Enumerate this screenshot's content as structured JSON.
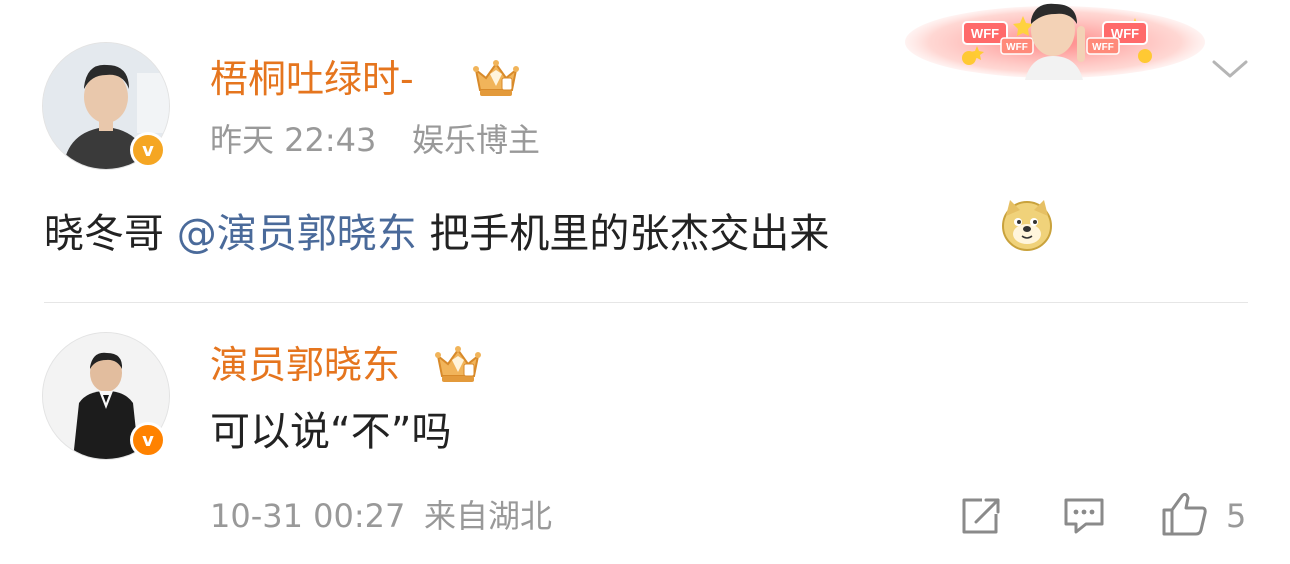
{
  "post": {
    "username": "梧桐吐绿时-",
    "time": "昨天 22:43",
    "role": "娱乐博主",
    "text_before": "晓冬哥 ",
    "mention": "@演员郭晓东",
    "text_after": " 把手机里的张杰交出来",
    "emoji": "doge-icon",
    "more": "chevron-down-icon"
  },
  "banner": {
    "badge_left": "WFF",
    "badge_left_small": "WFF",
    "badge_right": "WFF",
    "badge_right_small": "WFF"
  },
  "reply": {
    "username": "演员郭晓东",
    "text": "可以说“不”吗",
    "time": "10-31 00:27",
    "location": "来自湖北",
    "like_count": "5"
  },
  "colors": {
    "username": "#e5751e",
    "mention": "#4a6a9a",
    "meta": "#999999",
    "verified": "#f5a623",
    "verified_reply": "#ff8200"
  }
}
